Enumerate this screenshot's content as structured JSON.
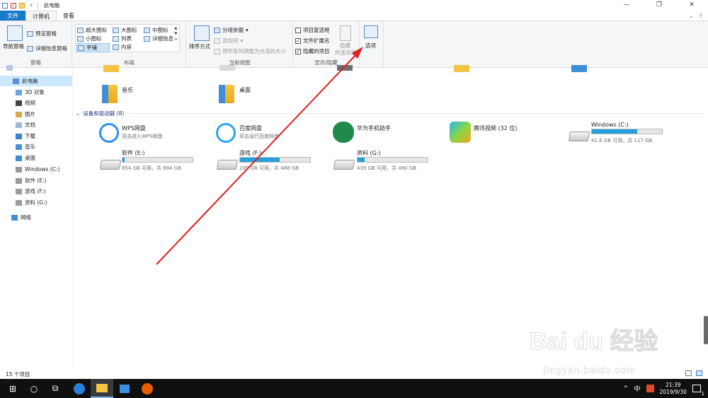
{
  "window": {
    "title": "此电脑",
    "minimize": "—",
    "maximize": "❐",
    "close": "✕"
  },
  "tabs": [
    {
      "label": "文件"
    },
    {
      "label": "计算机"
    },
    {
      "label": "查看"
    }
  ],
  "ribbon": {
    "pane_group": {
      "nav_pane": "导航窗格",
      "preview_pane": "预览窗格",
      "details_pane": "详细信息窗格",
      "label": "窗格"
    },
    "layout_group": {
      "extra_large": "超大图标",
      "large": "大图标",
      "medium": "中图标",
      "small": "小图标",
      "list": "列表",
      "details": "详细信息",
      "tiles": "平铺",
      "content": "内容",
      "label": "布局"
    },
    "view_group": {
      "sort": "排序方式",
      "group_by": "分组依据",
      "add_column": "添加列",
      "fit_columns": "将所有列调整为合适的大小",
      "label": "当前视图"
    },
    "show_group": {
      "item_checkbox": "项目复选框",
      "file_ext": "文件扩展名",
      "hidden_items": "隐藏的项目",
      "hide_selected_1": "隐藏",
      "hide_selected_2": "所选项目",
      "label": "显示/隐藏",
      "item_checkbox_checked": false,
      "file_ext_checked": true,
      "hidden_items_checked": true
    },
    "options": "选项"
  },
  "nav": {
    "this_pc": "此电脑",
    "items": [
      {
        "label": "3D 对象"
      },
      {
        "label": "视频"
      },
      {
        "label": "图片"
      },
      {
        "label": "文档"
      },
      {
        "label": "下载"
      },
      {
        "label": "音乐"
      },
      {
        "label": "桌面"
      },
      {
        "label": "Windows (C:)"
      },
      {
        "label": "软件 (E:)"
      },
      {
        "label": "游戏 (F:)"
      },
      {
        "label": "资料 (G:)"
      }
    ],
    "network": "网络"
  },
  "content": {
    "folders": [
      {
        "label": "音乐"
      },
      {
        "label": "桌面"
      }
    ],
    "section_title": "设备和驱动器 (8)",
    "apps": [
      {
        "name": "WPS网盘",
        "sub": "双击进入WPS网盘"
      },
      {
        "name": "百度网盘",
        "sub": "双击运行百度网盘"
      },
      {
        "name": "华为手机助手",
        "sub": ""
      },
      {
        "name": "腾讯视频 (32 位)",
        "sub": ""
      }
    ],
    "drives": [
      {
        "name": "Windows (C:)",
        "info": "41.6 GB 可用，共 117 GB",
        "used_fraction": 0.65
      },
      {
        "name": "软件 (E:)",
        "info": "854 GB 可用，共 884 GB",
        "used_fraction": 0.03
      },
      {
        "name": "游戏 (F:)",
        "info": "209 GB 可用，共 488 GB",
        "used_fraction": 0.57
      },
      {
        "name": "资料 (G:)",
        "info": "439 GB 可用，共 490 GB",
        "used_fraction": 0.1
      }
    ]
  },
  "status": {
    "count": "15 个项目"
  },
  "taskbar": {
    "ime": "中",
    "time": "21:39",
    "date": "2019/9/30",
    "notifications": "1"
  },
  "watermark": {
    "logo": "Bai du 经验",
    "url": "jingyan.baidu.com"
  },
  "colors": {
    "accent": "#1979ca",
    "bar_fill": "#26a0da",
    "arrow": "#e02020",
    "selection": "#cce8ff"
  }
}
